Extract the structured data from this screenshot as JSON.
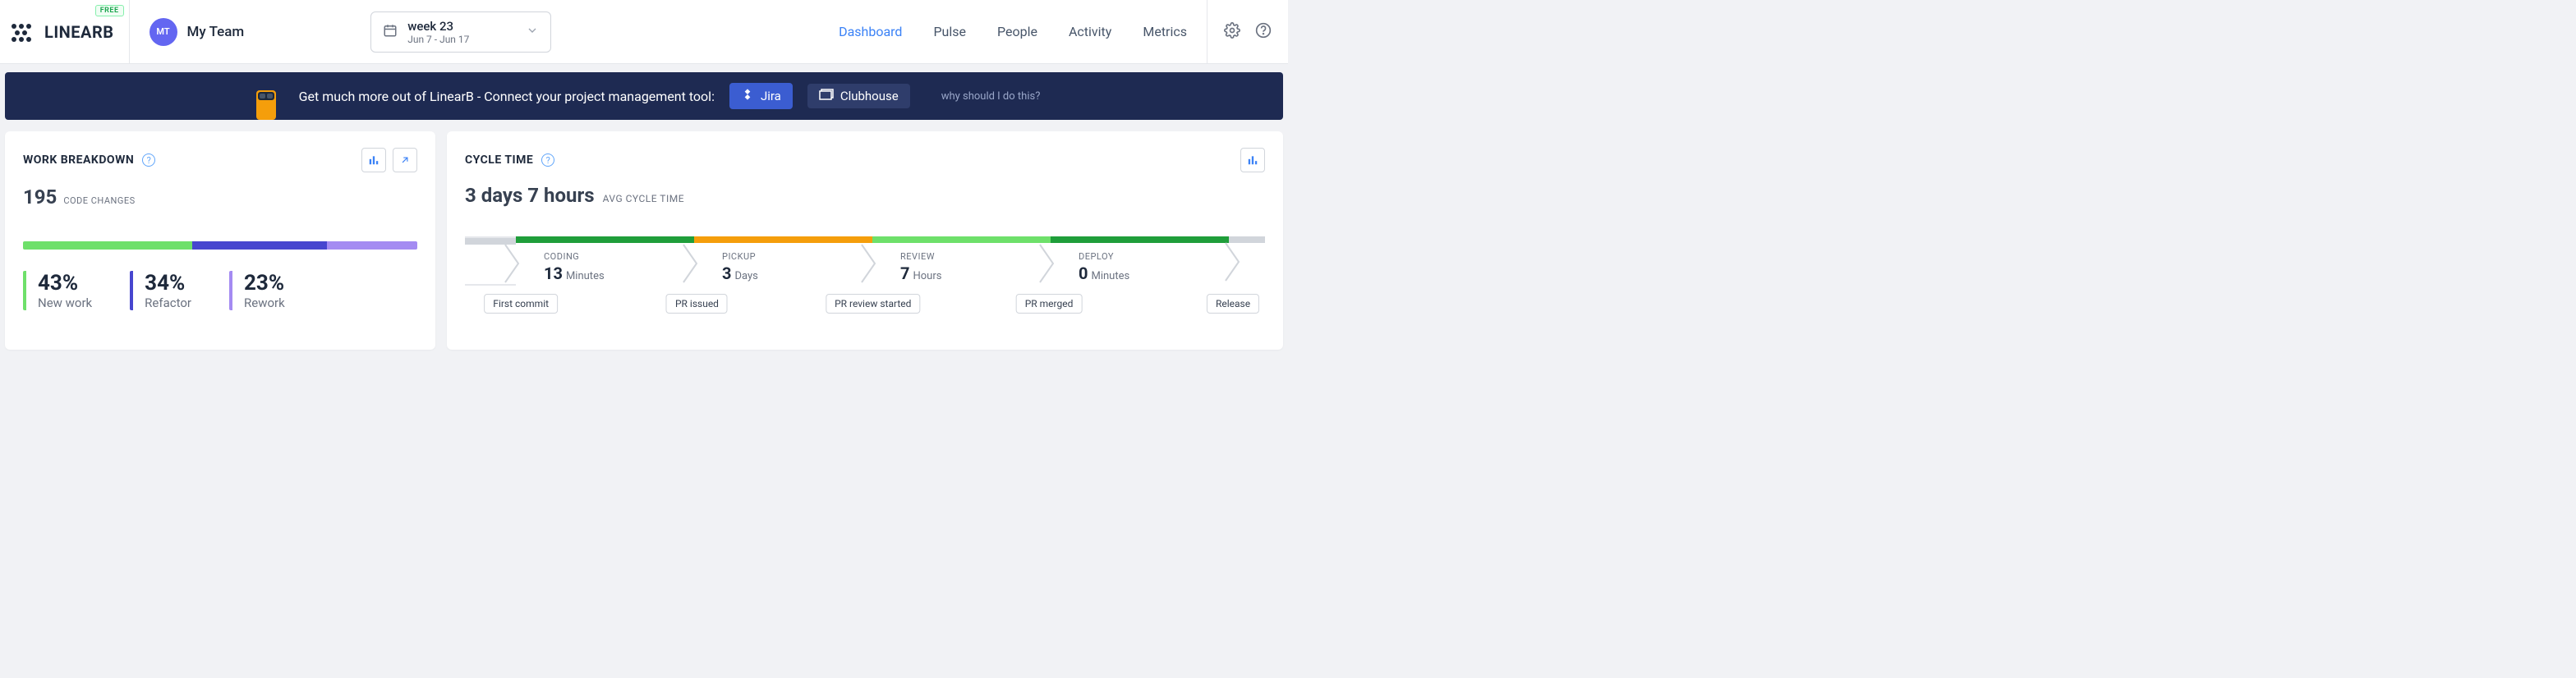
{
  "header": {
    "logo_text": "LINEARB",
    "free_badge": "FREE",
    "team_initials": "MT",
    "team_name": "My Team",
    "date_week": "week 23",
    "date_range": "Jun 7 - Jun 17",
    "nav": [
      "Dashboard",
      "Pulse",
      "People",
      "Activity",
      "Metrics"
    ],
    "nav_active": "Dashboard"
  },
  "banner": {
    "text": "Get much more out of LinearB - Connect your project management tool:",
    "jira": "Jira",
    "clubhouse": "Clubhouse",
    "why": "why should I do this?"
  },
  "work_breakdown": {
    "title": "WORK BREAKDOWN",
    "count": "195",
    "count_label": "CODE CHANGES",
    "stats": [
      {
        "pct": "43%",
        "label": "New work"
      },
      {
        "pct": "34%",
        "label": "Refactor"
      },
      {
        "pct": "23%",
        "label": "Rework"
      }
    ]
  },
  "cycle_time": {
    "title": "CYCLE TIME",
    "value": "3 days 7 hours",
    "value_label": "AVG CYCLE TIME",
    "stages": [
      {
        "name": "CODING",
        "num": "13",
        "unit": "Minutes",
        "color": "#1f9e3a"
      },
      {
        "name": "PICKUP",
        "num": "3",
        "unit": "Days",
        "color": "#f59e0b"
      },
      {
        "name": "REVIEW",
        "num": "7",
        "unit": "Hours",
        "color": "#6ee06a"
      },
      {
        "name": "DEPLOY",
        "num": "0",
        "unit": "Minutes",
        "color": "#1f9e3a"
      }
    ],
    "markers": [
      "First commit",
      "PR issued",
      "PR review started",
      "PR merged",
      "Release"
    ]
  },
  "chart_data": [
    {
      "type": "bar",
      "title": "Work Breakdown",
      "categories": [
        "New work",
        "Refactor",
        "Rework"
      ],
      "values": [
        43,
        34,
        23
      ],
      "unit": "%",
      "total_code_changes": 195
    },
    {
      "type": "table",
      "title": "Cycle Time Stages",
      "avg_cycle_time_hours": 79,
      "stages": [
        {
          "stage": "Coding",
          "value": 13,
          "unit": "minutes"
        },
        {
          "stage": "Pickup",
          "value": 3,
          "unit": "days"
        },
        {
          "stage": "Review",
          "value": 7,
          "unit": "hours"
        },
        {
          "stage": "Deploy",
          "value": 0,
          "unit": "minutes"
        }
      ]
    }
  ]
}
